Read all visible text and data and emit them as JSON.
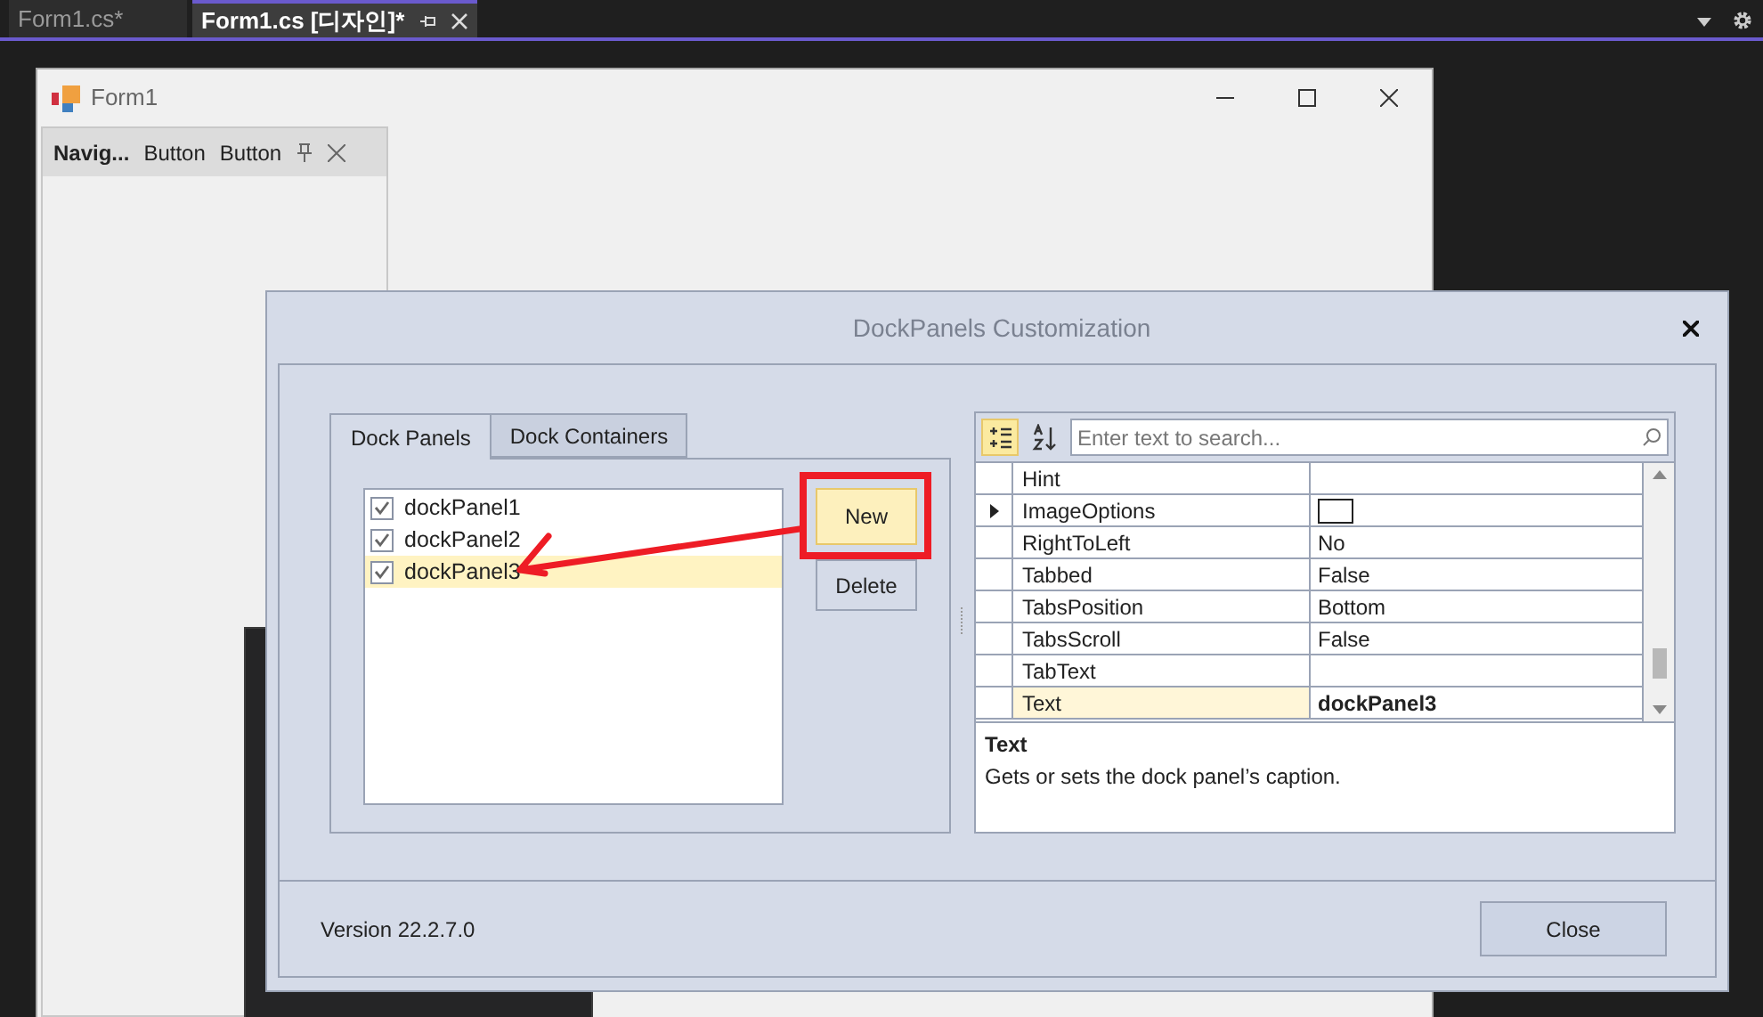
{
  "editor_tabs": [
    {
      "label": "Form1.cs*",
      "selected": false
    },
    {
      "label": "Form1.cs [디자인]*",
      "selected": true
    }
  ],
  "form": {
    "title": "Form1",
    "dock_panel": {
      "caption": "Navig...",
      "buttons": [
        "Button",
        "Button"
      ]
    }
  },
  "dialog": {
    "title": "DockPanels Customization",
    "tabs": [
      {
        "label": "Dock Panels",
        "selected": true
      },
      {
        "label": "Dock Containers",
        "selected": false
      }
    ],
    "panels": [
      {
        "name": "dockPanel1",
        "checked": true,
        "selected": false
      },
      {
        "name": "dockPanel2",
        "checked": true,
        "selected": false
      },
      {
        "name": "dockPanel3",
        "checked": true,
        "selected": true
      }
    ],
    "buttons": [
      {
        "label": "New",
        "highlighted": true
      },
      {
        "label": "Delete",
        "highlighted": false
      }
    ],
    "tool_buttons": [
      {
        "kind": "categorized",
        "selected": true
      },
      {
        "kind": "alphabetical",
        "selected": false
      }
    ],
    "search": {
      "placeholder": "Enter text to search..."
    },
    "properties": [
      {
        "name": "Hint",
        "kind": "text",
        "expandable": false,
        "selected": false
      },
      {
        "name": "ImageOptions",
        "kind": "swatch",
        "expandable": true,
        "selected": false
      },
      {
        "name": "RightToLeft",
        "kind": "text",
        "value": "No",
        "expandable": false,
        "selected": false
      },
      {
        "name": "Tabbed",
        "kind": "text",
        "value": "False",
        "expandable": false,
        "selected": false
      },
      {
        "name": "TabsPosition",
        "kind": "text",
        "value": "Bottom",
        "expandable": false,
        "selected": false
      },
      {
        "name": "TabsScroll",
        "kind": "text",
        "value": "False",
        "expandable": false,
        "selected": false
      },
      {
        "name": "TabText",
        "kind": "text",
        "expandable": false,
        "selected": false
      },
      {
        "name": "Text",
        "kind": "text",
        "value": "dockPanel3",
        "expandable": false,
        "selected": true
      }
    ],
    "description": {
      "title": "Text",
      "text": "Gets or sets the dock panel’s caption."
    },
    "version": "Version 22.2.7.0",
    "close_button": "Close"
  }
}
